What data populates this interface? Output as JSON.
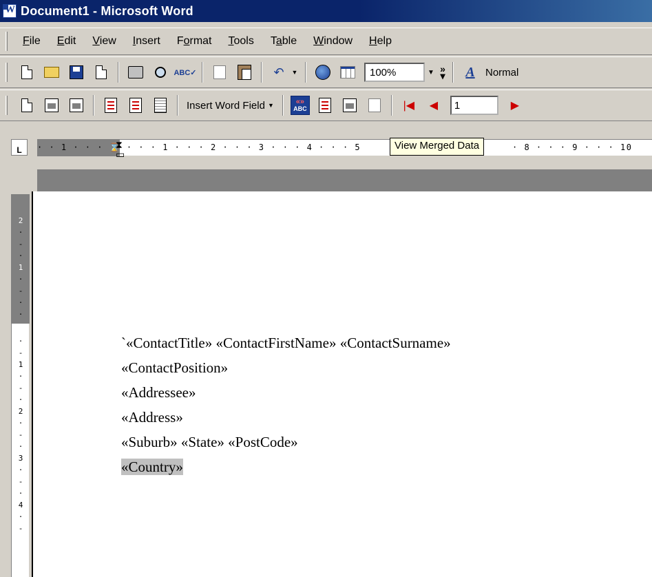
{
  "window": {
    "title": "Document1 - Microsoft Word"
  },
  "menu": [
    "File",
    "Edit",
    "View",
    "Insert",
    "Format",
    "Tools",
    "Table",
    "Window",
    "Help"
  ],
  "menu_mnemonics": [
    "F",
    "E",
    "V",
    "I",
    "o",
    "T",
    "a",
    "W",
    "H"
  ],
  "standard_toolbar": {
    "zoom": "100%",
    "style": "Normal",
    "icons": [
      "new-document-icon",
      "open-folder-icon",
      "save-disk-icon",
      "permission-icon",
      "print-icon",
      "print-preview-icon",
      "spelling-icon",
      "copy-icon",
      "paste-icon",
      "undo-icon",
      "web-globe-icon",
      "insert-table-icon",
      "styles-icon"
    ]
  },
  "mail_merge_toolbar": {
    "insert_word_field": "Insert Word Field",
    "record_number": "1",
    "icons": [
      "main-document-setup-icon",
      "open-data-source-icon",
      "mail-merge-recipients-icon",
      "insert-address-block-icon",
      "insert-greeting-line-icon",
      "insert-merge-fields-icon",
      "view-merged-data-icon",
      "highlight-merge-fields-icon",
      "match-fields-icon",
      "propagate-labels-icon",
      "first-record-icon",
      "previous-record-icon",
      "next-record-icon"
    ]
  },
  "tooltip": "View Merged Data",
  "ruler": {
    "h_ticks": "· · 1 · · · ⌛ · · · 1 · · · 2 · · · 3 · · · 4 · · · 5",
    "h_ticks_right": "· 8 · · · 9 · · · 10",
    "v_ticks": [
      "2",
      "1",
      "",
      "1",
      "2",
      "3",
      "4"
    ]
  },
  "document": {
    "lines": [
      "`«ContactTitle» «ContactFirstName» «ContactSurname»",
      "«ContactPosition»",
      "«Addressee»",
      "«Address»",
      "«Suburb» «State» «PostCode»"
    ],
    "selected_line": "«Country»"
  }
}
